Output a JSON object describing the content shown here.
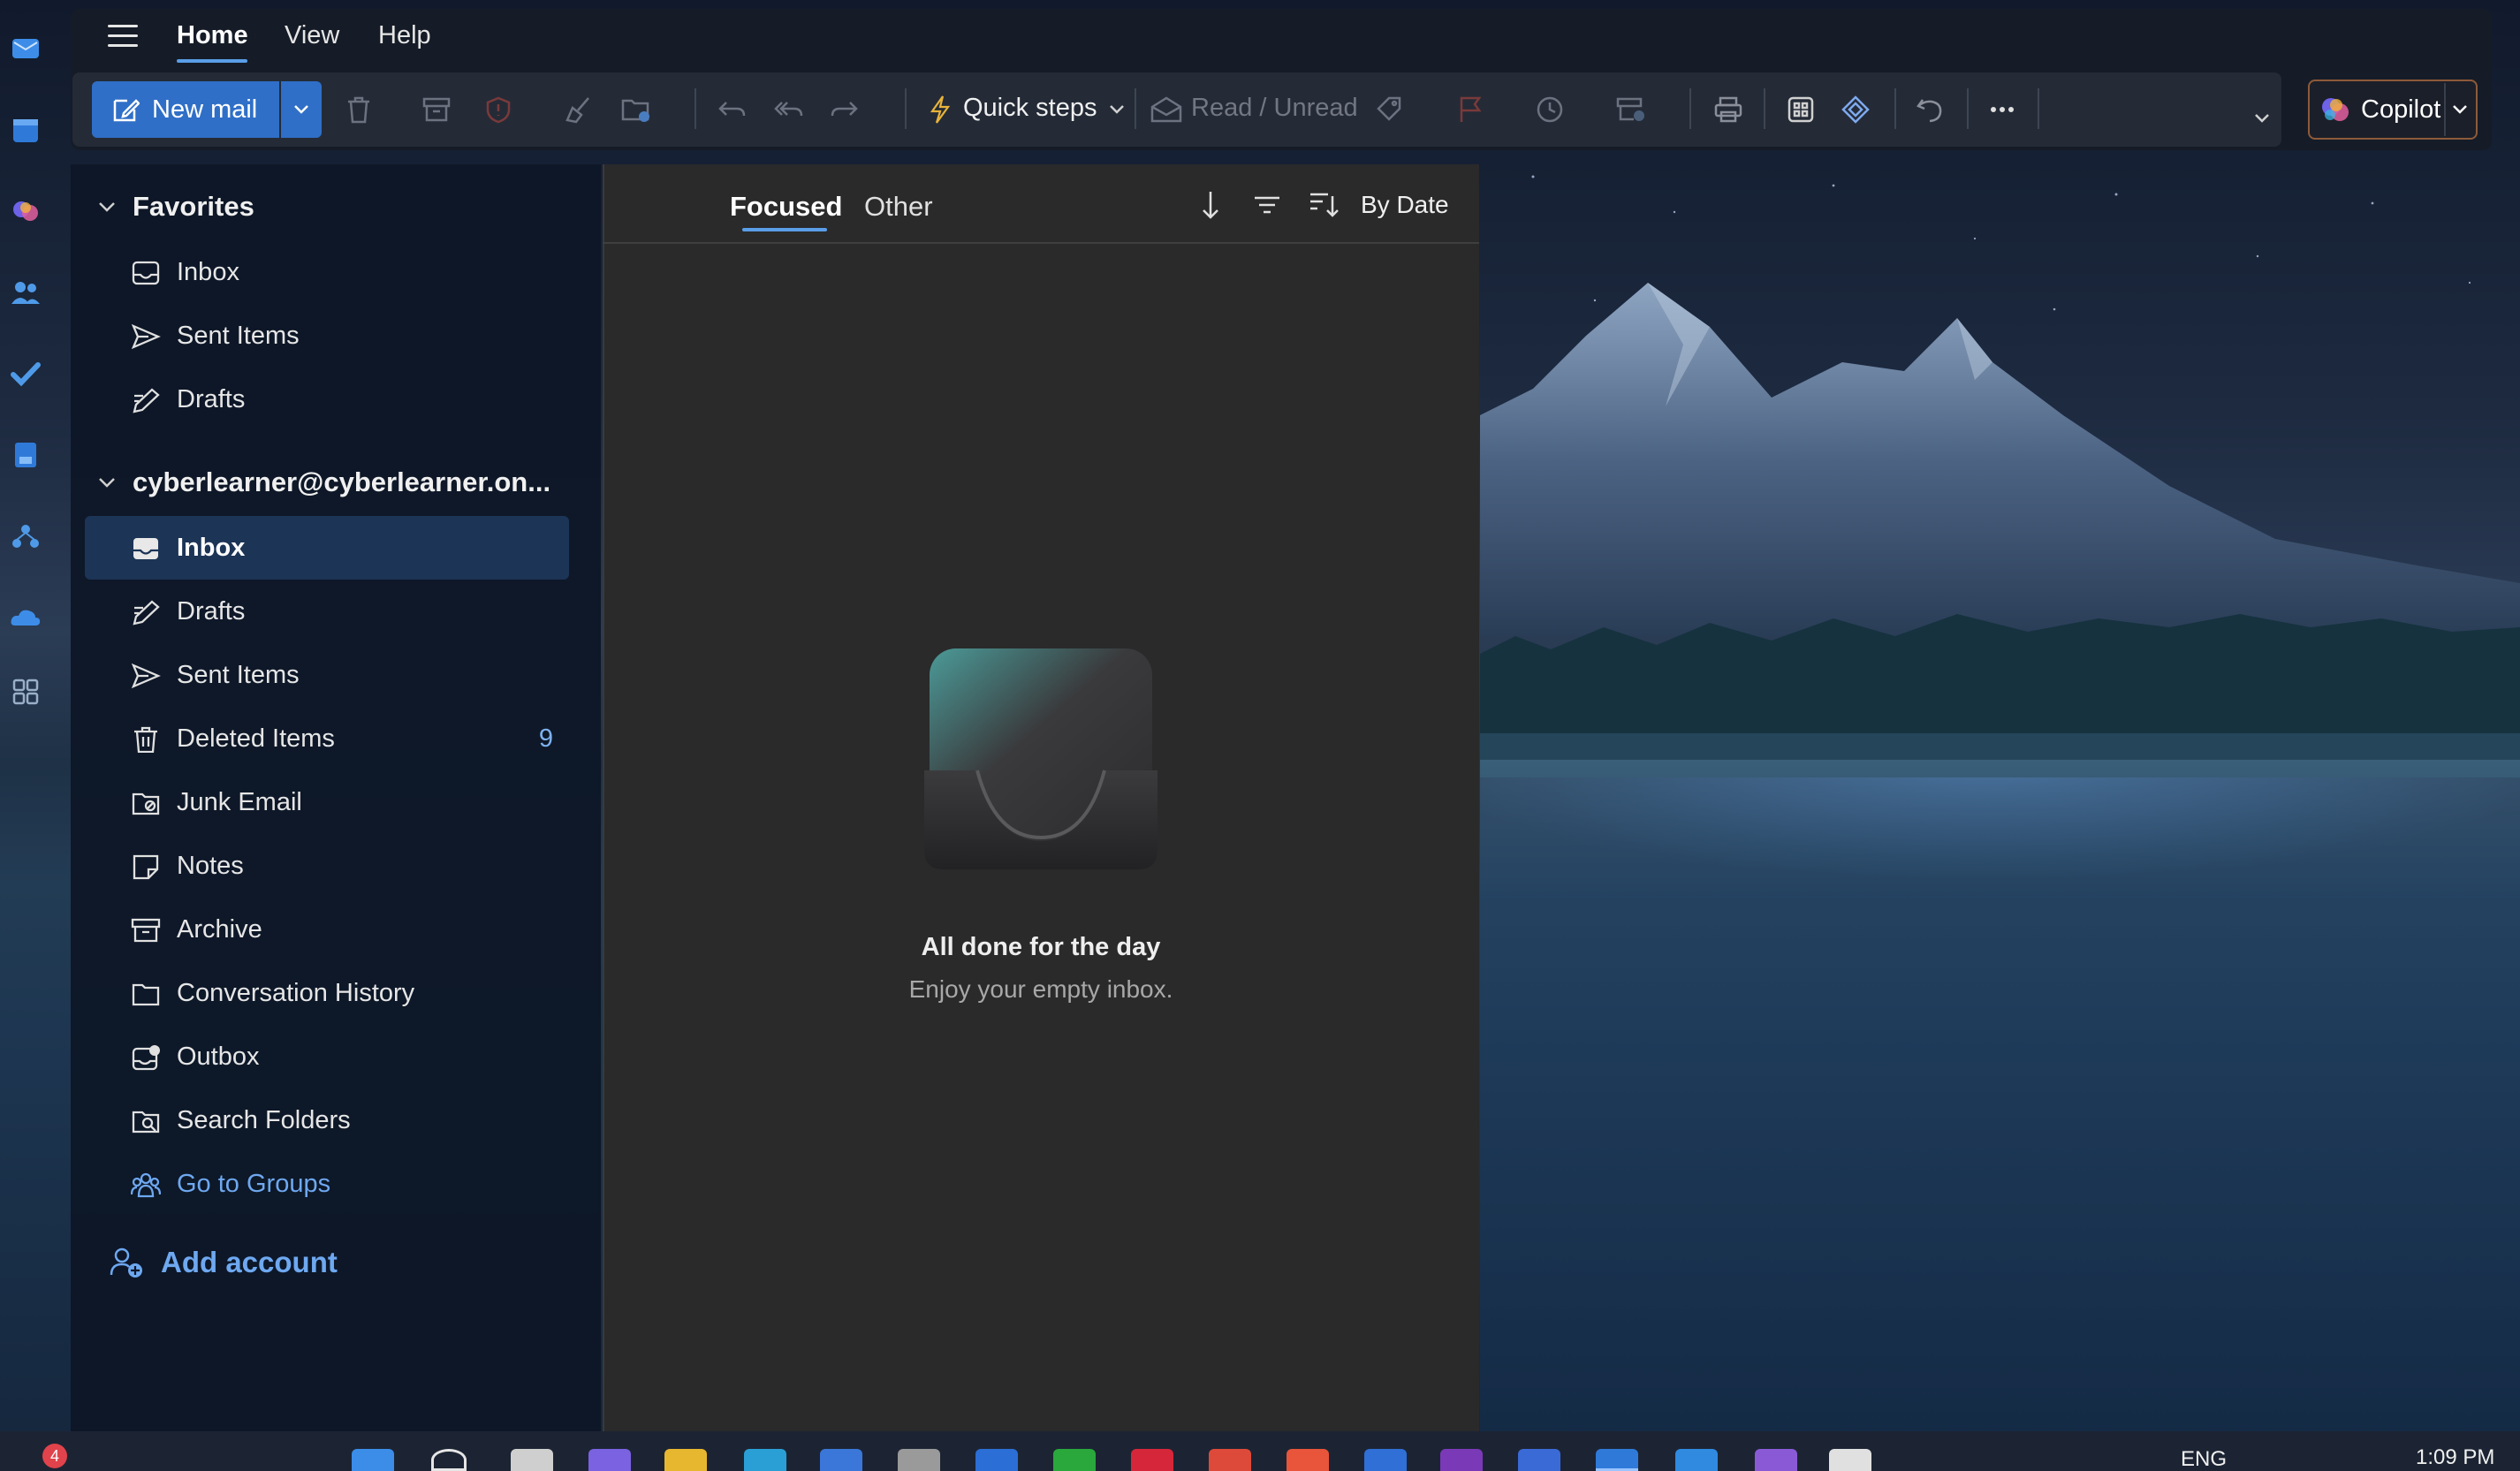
{
  "menu": {
    "tabs": [
      {
        "label": "Home",
        "active": true
      },
      {
        "label": "View",
        "active": false
      },
      {
        "label": "Help",
        "active": false
      }
    ]
  },
  "toolbar": {
    "new_mail_label": "New mail",
    "quick_steps_label": "Quick steps",
    "read_unread_label": "Read / Unread",
    "copilot_label": "Copilot"
  },
  "folders": {
    "favorites_header": "Favorites",
    "favorites": [
      {
        "label": "Inbox",
        "icon": "inbox-icon"
      },
      {
        "label": "Sent Items",
        "icon": "send-icon"
      },
      {
        "label": "Drafts",
        "icon": "drafts-icon"
      }
    ],
    "account_header": "cyberlearner@cyberlearner.on...",
    "account_folders": [
      {
        "label": "Inbox",
        "icon": "inbox-icon",
        "selected": true
      },
      {
        "label": "Drafts",
        "icon": "drafts-icon"
      },
      {
        "label": "Sent Items",
        "icon": "send-icon"
      },
      {
        "label": "Deleted Items",
        "icon": "trash-icon",
        "count": "9"
      },
      {
        "label": "Junk Email",
        "icon": "junk-icon"
      },
      {
        "label": "Notes",
        "icon": "notes-icon"
      },
      {
        "label": "Archive",
        "icon": "archive-icon"
      },
      {
        "label": "Conversation History",
        "icon": "folder-icon"
      },
      {
        "label": "Outbox",
        "icon": "outbox-icon"
      },
      {
        "label": "Search Folders",
        "icon": "search-folder-icon"
      },
      {
        "label": "Go to Groups",
        "icon": "groups-icon"
      }
    ],
    "add_account_label": "Add account"
  },
  "message_list": {
    "pivots": [
      {
        "label": "Focused",
        "active": true
      },
      {
        "label": "Other",
        "active": false
      }
    ],
    "sort_label": "By Date",
    "empty_title": "All done for the day",
    "empty_subtitle": "Enjoy your empty inbox."
  },
  "taskbar": {
    "notification_badge": "4",
    "language": "ENG",
    "time": "1:09 PM"
  },
  "colors": {
    "accent": "#2f6fc7",
    "selected_folder": "#1c3456",
    "link": "#6ea8f0",
    "count": "#7fb1ef"
  }
}
